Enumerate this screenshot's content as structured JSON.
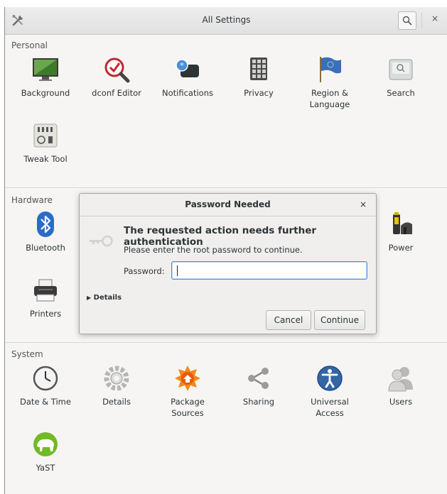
{
  "header": {
    "title": "All Settings",
    "tools_icon": "tools-icon",
    "search_icon": "search-icon",
    "close_glyph": "×"
  },
  "sections": {
    "personal": {
      "title": "Personal",
      "items": [
        {
          "label": "Background",
          "icon": "background-icon"
        },
        {
          "label": "dconf Editor",
          "icon": "dconf-editor-icon"
        },
        {
          "label": "Notifications",
          "icon": "notifications-icon"
        },
        {
          "label": "Privacy",
          "icon": "privacy-icon"
        },
        {
          "label": "Region &\nLanguage",
          "icon": "region-language-icon"
        },
        {
          "label": "Search",
          "icon": "search-settings-icon"
        },
        {
          "label": "Tweak Tool",
          "icon": "tweak-tool-icon"
        }
      ]
    },
    "hardware": {
      "title": "Hardware",
      "items": [
        {
          "label": "Bluetooth",
          "icon": "bluetooth-icon"
        },
        {
          "label": "Power",
          "icon": "power-icon"
        },
        {
          "label": "Printers",
          "icon": "printers-icon"
        }
      ]
    },
    "system": {
      "title": "System",
      "items": [
        {
          "label": "Date & Time",
          "icon": "date-time-icon"
        },
        {
          "label": "Details",
          "icon": "details-icon"
        },
        {
          "label": "Package\nSources",
          "icon": "package-sources-icon"
        },
        {
          "label": "Sharing",
          "icon": "sharing-icon"
        },
        {
          "label": "Universal\nAccess",
          "icon": "universal-access-icon"
        },
        {
          "label": "Users",
          "icon": "users-icon"
        },
        {
          "label": "YaST",
          "icon": "yast-icon"
        }
      ]
    }
  },
  "dialog": {
    "title": "Password Needed",
    "close_glyph": "×",
    "heading": "The requested action needs further authentication",
    "message": "Please enter the root password to continue.",
    "password_label": "Password:",
    "password_value": "",
    "details_label": "Details",
    "cancel_label": "Cancel",
    "continue_label": "Continue",
    "key_icon": "key-icon",
    "accent_color": "#4a90d9"
  }
}
